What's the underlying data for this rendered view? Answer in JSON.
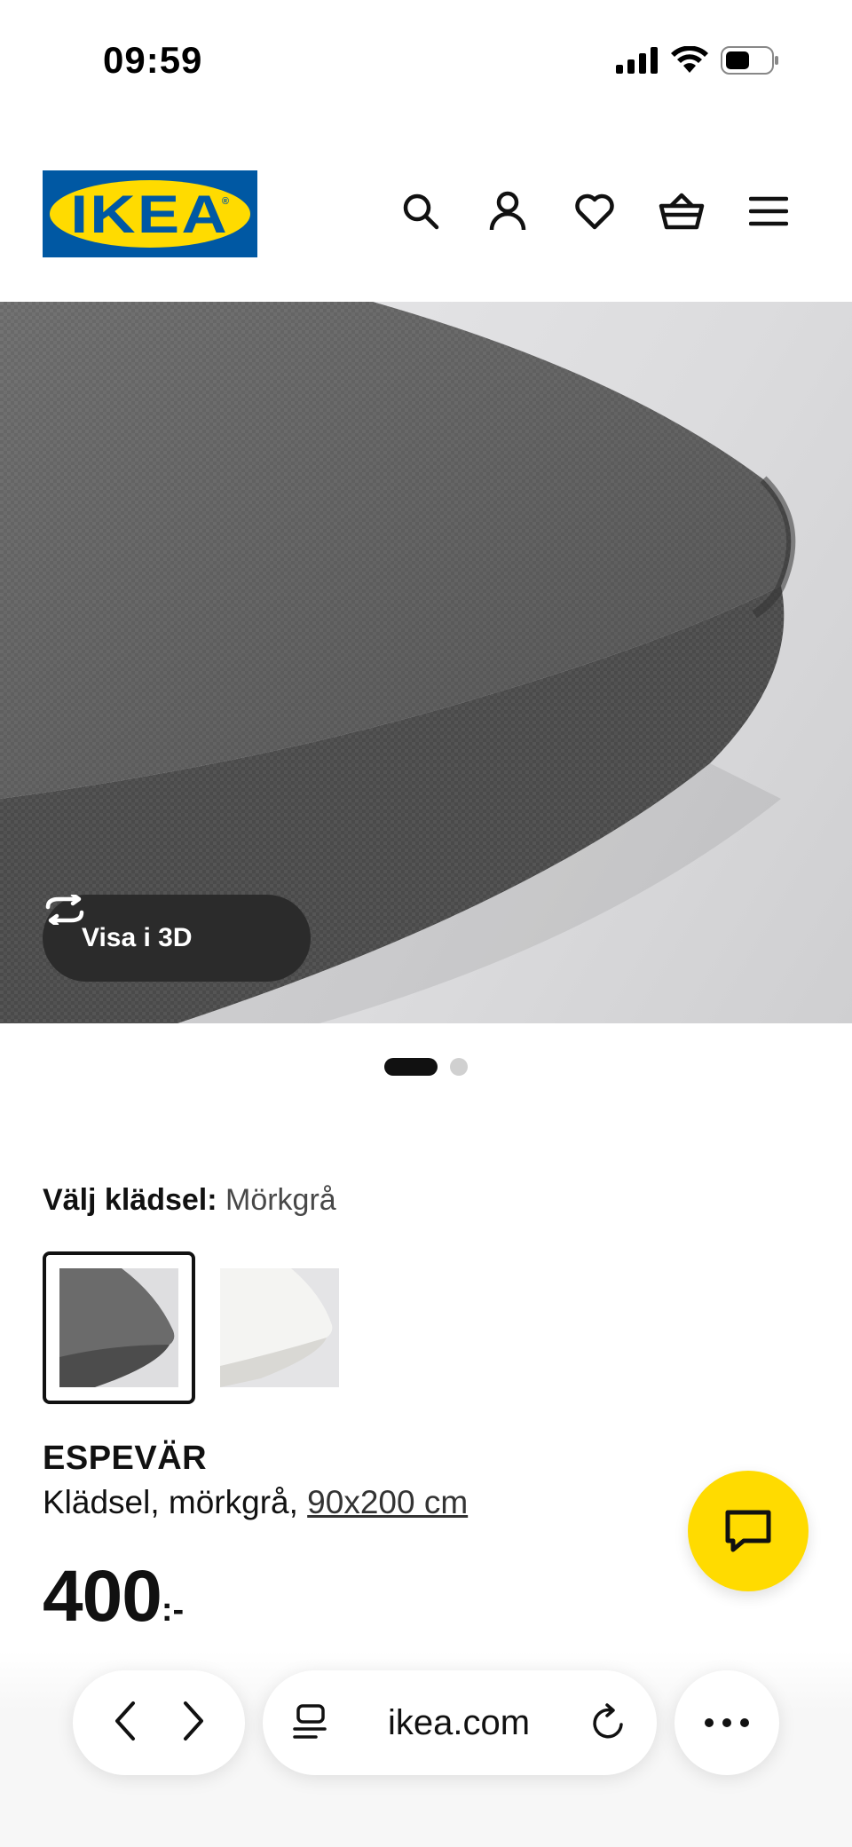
{
  "status_bar": {
    "time": "09:59"
  },
  "header": {
    "logo_text": "IKEA",
    "icons": [
      "search-icon",
      "account-icon",
      "heart-icon",
      "basket-icon",
      "menu-icon"
    ]
  },
  "gallery": {
    "view_3d_label": "Visa i 3D",
    "page_count": 2,
    "active_page": 1
  },
  "options": {
    "label": "Välj klädsel:",
    "value": "Mörkgrå",
    "swatches": [
      {
        "name": "Mörkgrå",
        "selected": true
      },
      {
        "name": "Vit",
        "selected": false
      }
    ]
  },
  "product": {
    "name": "ESPEVÄR",
    "description": "Klädsel, mörkgrå,",
    "size": "90x200 cm",
    "price": "400",
    "price_suffix": ":-"
  },
  "browser": {
    "url": "ikea.com"
  },
  "colors": {
    "ikea_blue": "#0058a3",
    "ikea_yellow": "#ffdb00",
    "fabric_dark": "#5a5a5a"
  }
}
